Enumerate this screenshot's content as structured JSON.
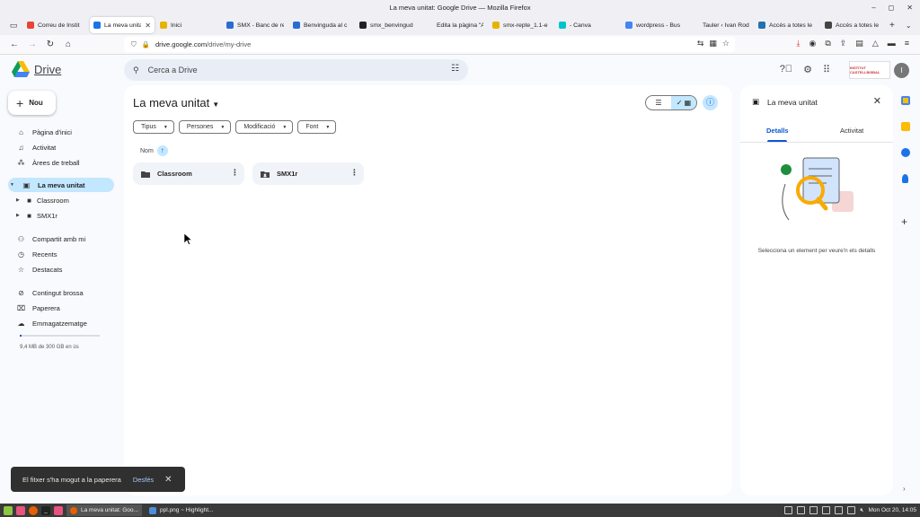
{
  "window": {
    "title": "La meva unitat: Google Drive — Mozilla Firefox"
  },
  "browser": {
    "tabs": [
      {
        "label": "Correu de Instit",
        "favicon_color": "#ea4335"
      },
      {
        "label": "La meva unitat",
        "favicon_color": "#1a73e8",
        "active": true
      },
      {
        "label": "Inici",
        "favicon_color": "#e5b400"
      },
      {
        "label": "SMX - Banc de re",
        "favicon_color": "#2b6cd4"
      },
      {
        "label": "Benvinguda al c",
        "favicon_color": "#2b6cd4"
      },
      {
        "label": "smx_benvingud",
        "favicon_color": "#222222"
      },
      {
        "label": "Edita la pàgina \"Acc",
        "favicon_color": "#f0f0f4"
      },
      {
        "label": "smx-repte_1.1-e",
        "favicon_color": "#e5b400"
      },
      {
        "label": "- Canva",
        "favicon_color": "#00c4cc"
      },
      {
        "label": "wordpress - Bus",
        "favicon_color": "#4285f4"
      },
      {
        "label": "Tauler ‹ Ivan Rodrig",
        "favicon_color": "#f0f0f4"
      },
      {
        "label": "Accés a totes le",
        "favicon_color": "#2271b1"
      },
      {
        "label": "Accés a totes le",
        "favicon_color": "#444444"
      }
    ],
    "url_host": "drive.google.com",
    "url_path": "/drive/my-drive"
  },
  "drive": {
    "app_name": "Drive",
    "search_placeholder": "Cerca a Drive",
    "new_button": "Nou",
    "avatar_initial": "I",
    "org_logo_text": "INSTITUT CASTELLBISBAL",
    "sidebar": {
      "items": [
        {
          "label": "Pàgina d'inici",
          "icon": "home-icon",
          "glyph": "⌂"
        },
        {
          "label": "Activitat",
          "icon": "bell-icon",
          "glyph": "🔔"
        },
        {
          "label": "Àrees de treball",
          "icon": "workspaces-icon",
          "glyph": "⁂"
        },
        {
          "label": "La meva unitat",
          "icon": "my-drive-icon",
          "glyph": "▣"
        },
        {
          "label": "Classroom",
          "icon": "folder-icon",
          "glyph": "■"
        },
        {
          "label": "SMX1r",
          "icon": "shared-folder-icon",
          "glyph": "■"
        },
        {
          "label": "Compartit amb mi",
          "icon": "people-icon",
          "glyph": "👥"
        },
        {
          "label": "Recents",
          "icon": "clock-icon",
          "glyph": "◷"
        },
        {
          "label": "Destacats",
          "icon": "star-icon",
          "glyph": "☆"
        },
        {
          "label": "Contingut brossa",
          "icon": "spam-icon",
          "glyph": "⊘"
        },
        {
          "label": "Paperera",
          "icon": "trash-icon",
          "glyph": "🗑"
        },
        {
          "label": "Emmagatzematge",
          "icon": "cloud-icon",
          "glyph": "☁"
        }
      ],
      "storage_text": "9,4 MB de 300 GB en ús",
      "storage_used_fraction": 3e-05
    },
    "main": {
      "title": "La meva unitat",
      "filters": [
        "Tipus",
        "Persones",
        "Modificació",
        "Font"
      ],
      "sort_label": "Nom",
      "folders": [
        {
          "name": "Classroom",
          "type": "folder"
        },
        {
          "name": "SMX1r",
          "type": "shared-folder"
        }
      ]
    },
    "details": {
      "title": "La meva unitat",
      "tabs": [
        "Detalls",
        "Activitat"
      ],
      "hint": "Selecciona un element per veure'n els detalls"
    },
    "snackbar": {
      "message": "El fitxer s'ha mogut a la paperera",
      "action": "Desfés"
    }
  },
  "taskbar": {
    "apps": [
      {
        "label": "La meva unitat: Goo...",
        "active": true
      },
      {
        "label": "ppl.png ~ Highlight...",
        "active": false
      }
    ],
    "clock": "Mon Oct 20, 14:05"
  },
  "colors": {
    "accent": "#0b57d0",
    "selected": "#c2e7ff",
    "surface": "#f8fafd"
  }
}
